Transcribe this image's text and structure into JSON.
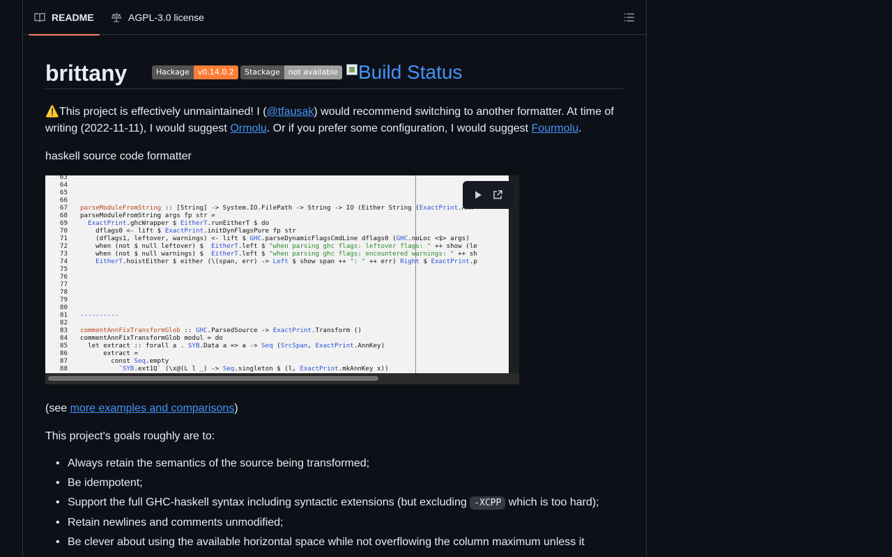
{
  "tabs": {
    "readme": "README",
    "license": "AGPL-3.0 license"
  },
  "readme": {
    "title": "brittany",
    "badges": {
      "hackage_label": "Hackage",
      "hackage_value": "v0.14.0.2",
      "stackage_label": "Stackage",
      "stackage_value": "not available",
      "build_alt": "Build Status"
    },
    "notice": {
      "emoji": "⚠️",
      "part1": "This project is effectively unmaintained! I (",
      "user_link": "@tfausak",
      "part2": ") would recommend switching to another formatter. At time of writing (2022-11-11), I would suggest ",
      "ormolu_link": "Ormolu",
      "part3": ". Or if you prefer some configuration, I would suggest ",
      "fourmolu_link": "Fourmolu",
      "part4": "."
    },
    "tagline": "haskell source code formatter",
    "see": {
      "prefix": "(see ",
      "link": "more examples and comparisons",
      "suffix": ")"
    },
    "goals_intro": "This project's goals roughly are to:",
    "goals": [
      "Always retain the semantics of the source being transformed;",
      "Be idempotent;",
      "Support the full GHC-haskell syntax including syntactic extensions (but excluding ",
      "Retain newlines and comments unmodified;",
      "Be clever about using the available horizontal space while not overflowing the column maximum unless it"
    ],
    "goal3_code": "-XCPP",
    "goal3_suffix": " which is too hard);"
  },
  "video": {
    "code_lines": [
      {
        "n": "63",
        "t": ""
      },
      {
        "n": "64",
        "t": ""
      },
      {
        "n": "65",
        "t": ""
      },
      {
        "n": "66",
        "t": ""
      },
      {
        "n": "67",
        "t": "parseModuleFromString :: [String] -> System.IO.FilePath -> String -> IO (Either String (ExactPrint.Ann"
      },
      {
        "n": "68",
        "t": "parseModuleFromString args fp str ="
      },
      {
        "n": "69",
        "t": "  ExactPrint.ghcWrapper $ EitherT.runEitherT $ do"
      },
      {
        "n": "70",
        "t": "    dflags0 <- lift $ ExactPrint.initDynFlagsPure fp str"
      },
      {
        "n": "71",
        "t": "    (dflags1, leftover, warnings) <- lift $ GHC.parseDynamicFlagsCmdLine dflags0 (GHC.noLoc <$> args)"
      },
      {
        "n": "72",
        "t": "    when (not $ null leftover) $  EitherT.left $ \"when parsing ghc flags: leftover flags: \" ++ show (le"
      },
      {
        "n": "73",
        "t": "    when (not $ null warnings) $  EitherT.left $ \"when parsing ghc flags: encountered warnings: \" ++ sh"
      },
      {
        "n": "74",
        "t": "    EitherT.hoistEither $ either (\\(span, err) -> Left $ show span ++ \": \" ++ err) Right $ ExactPrint.p"
      },
      {
        "n": "75",
        "t": ""
      },
      {
        "n": "76",
        "t": ""
      },
      {
        "n": "77",
        "t": ""
      },
      {
        "n": "78",
        "t": ""
      },
      {
        "n": "79",
        "t": ""
      },
      {
        "n": "80",
        "t": ""
      },
      {
        "n": "81",
        "t": "----------"
      },
      {
        "n": "82",
        "t": ""
      },
      {
        "n": "83",
        "t": "commentAnnFixTransformGlob :: GHC.ParsedSource -> ExactPrint.Transform ()"
      },
      {
        "n": "84",
        "t": "commentAnnFixTransformGlob modul = do"
      },
      {
        "n": "85",
        "t": "  let extract :: forall a . SYB.Data a => a -> Seq (SrcSpan, ExactPrint.AnnKey)"
      },
      {
        "n": "86",
        "t": "      extract ="
      },
      {
        "n": "87",
        "t": "        const Seq.empty"
      },
      {
        "n": "88",
        "t": "          `SYB.ext1Q` (\\x@(L l _) -> Seq.singleton $ (l, ExactPrint.mkAnnKey x))"
      }
    ]
  }
}
